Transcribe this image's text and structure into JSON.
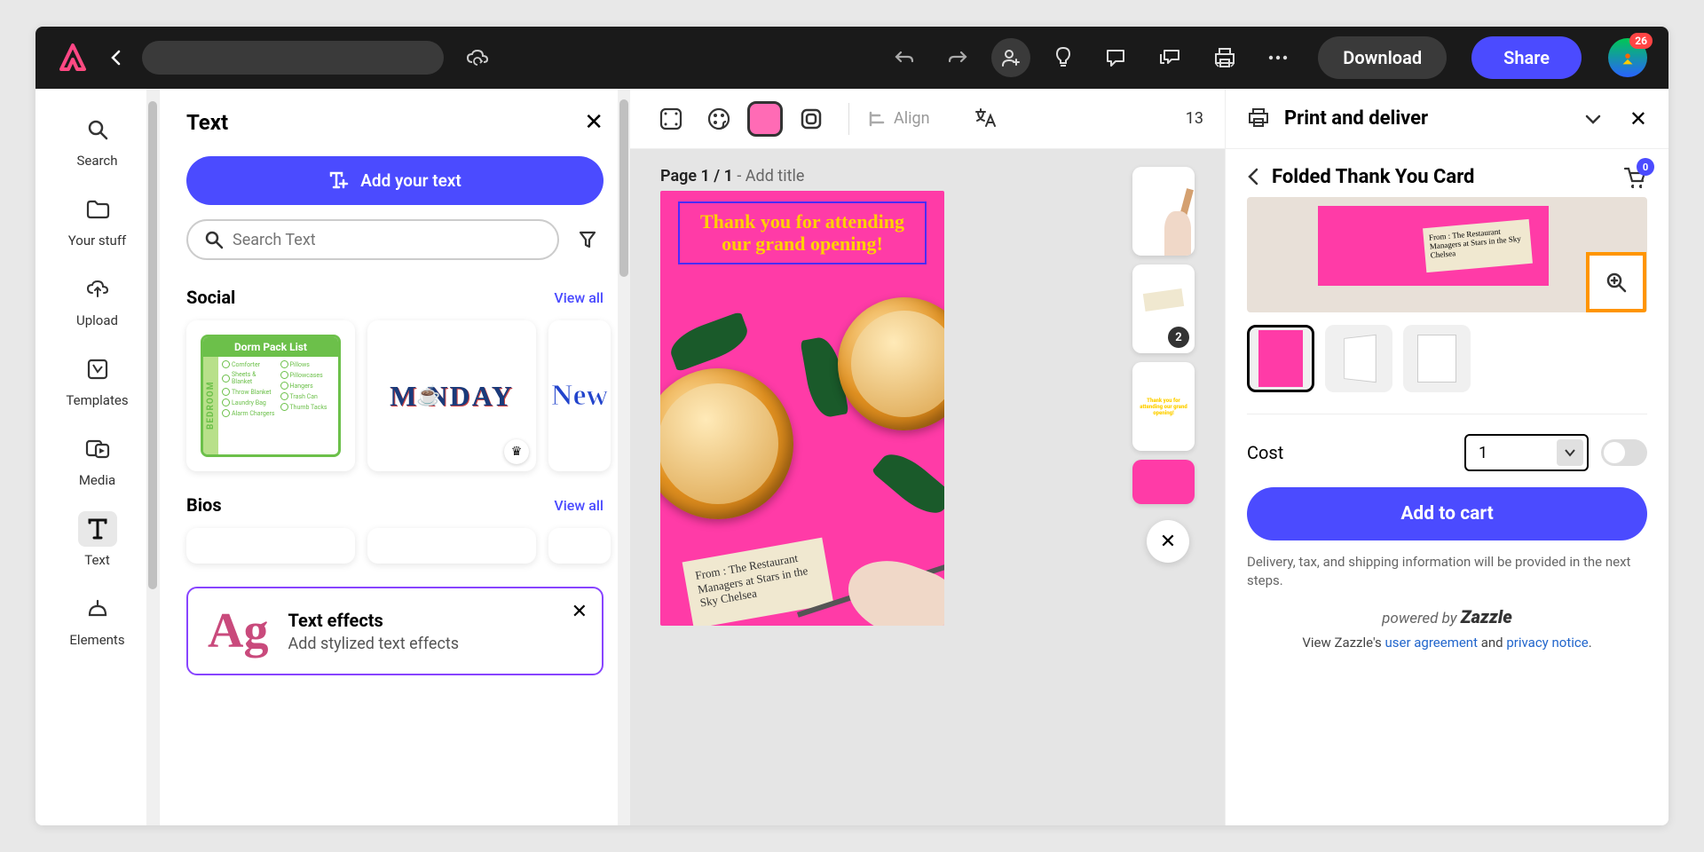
{
  "topbar": {
    "download_label": "Download",
    "share_label": "Share",
    "avatar_badge": "26"
  },
  "left_rail": {
    "items": [
      {
        "label": "Search"
      },
      {
        "label": "Your stuff"
      },
      {
        "label": "Upload"
      },
      {
        "label": "Templates"
      },
      {
        "label": "Media"
      },
      {
        "label": "Text"
      },
      {
        "label": "Elements"
      }
    ]
  },
  "text_panel": {
    "title": "Text",
    "add_button": "Add your text",
    "search_placeholder": "Search Text",
    "sections": {
      "social": {
        "title": "Social",
        "view_all": "View all"
      },
      "bios": {
        "title": "Bios",
        "view_all": "View all"
      }
    },
    "dorm": {
      "title": "Dorm Pack List",
      "side": "BEDROOM",
      "col1": [
        "Comforter",
        "Sheets & Blanket",
        "Throw Blanket",
        "Laundry Bag",
        "Alarm Chargers"
      ],
      "col2": [
        "Pillows",
        "Pillowcases",
        "Hangers",
        "Trash Can",
        "Thumb Tacks"
      ]
    },
    "monday": "M   NDAY",
    "new": "New",
    "effects": {
      "title": "Text effects",
      "subtitle": "Add stylized text effects",
      "sample": "Ag"
    }
  },
  "canvas": {
    "align_label": "Align",
    "zoom": "13",
    "page_label_prefix": "Page 1 / 1",
    "page_label_suffix": " - Add title",
    "card_headline": "Thank you for attending our grand opening!",
    "tag_text": "From : The Restaurant Managers at Stars in the Sky Chelsea",
    "thumb2_badge": "2",
    "thumb3_text": "Thank you for attending our grand opening!"
  },
  "print_panel": {
    "title": "Print and deliver",
    "subtitle": "Folded Thank You Card",
    "cart_count": "0",
    "hero_tag": "From : The Restaurant Managers at Stars in the Sky Chelsea",
    "cost_label": "Cost",
    "qty": "1",
    "add_to_cart": "Add to cart",
    "disclaimer": "Delivery, tax, and shipping information will be provided in the next steps.",
    "powered_prefix": "powered by ",
    "powered_brand": "Zazzle",
    "legal_prefix": "View Zazzle's ",
    "legal_agreement": "user agreement",
    "legal_and": " and ",
    "legal_privacy": "privacy notice",
    "legal_suffix": "."
  }
}
